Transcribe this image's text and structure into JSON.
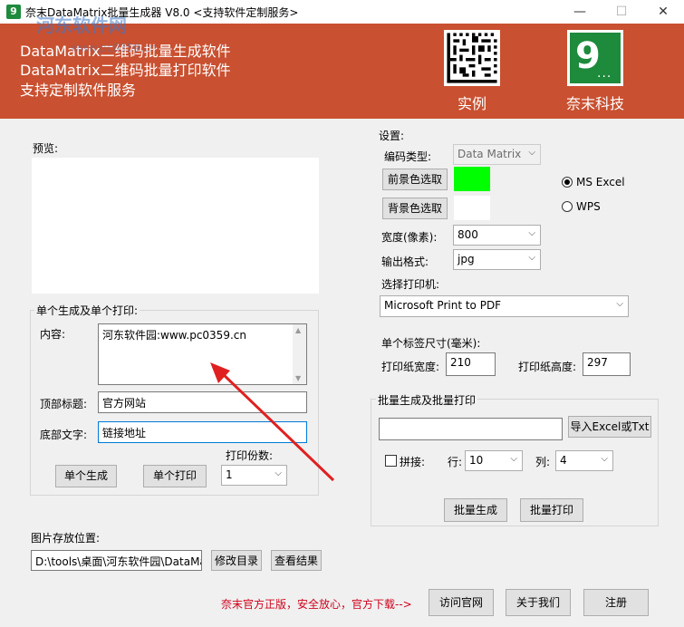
{
  "window": {
    "title": "奈末DataMatrix批量生成器 V8.0  <支持软件定制服务>",
    "app_icon": "9",
    "minimize": "—",
    "maximize": "☐",
    "close": "✕"
  },
  "watermark": {
    "text": "河东软件网",
    "url": "www.pc0359.cn"
  },
  "banner": {
    "lines": [
      "DataMatrix二维码批量生成软件",
      "DataMatrix二维码批量打印软件",
      "支持定制软件服务"
    ],
    "example_label": "实例",
    "company_label": "奈末科技",
    "logo_glyph": "9",
    "logo_dots": "...",
    "bg_color": "#c95030",
    "logo_color": "#1e8a3c"
  },
  "preview": {
    "label": "预览:"
  },
  "single": {
    "group_label": "单个生成及单个打印:",
    "content_label": "内容:",
    "content_value": "河东软件园:www.pc0359.cn",
    "top_title_label": "顶部标题:",
    "top_title_value": "官方网站",
    "bottom_text_label": "底部文字:",
    "bottom_text_value": "链接地址",
    "copies_label": "打印份数:",
    "copies_value": "1",
    "generate_button": "单个生成",
    "print_button": "单个打印"
  },
  "storage": {
    "label": "图片存放位置:",
    "path_value": "D:\\tools\\桌面\\河东软件园\\DataMa",
    "change_dir_button": "修改目录",
    "view_result_button": "查看结果"
  },
  "settings": {
    "group_label": "设置:",
    "code_type_label": "编码类型:",
    "code_type_value": "Data Matrix",
    "fg_color_button": "前景色选取",
    "fg_color": "#00ff00",
    "bg_color_button": "背景色选取",
    "bg_color": "#ffffff",
    "radio_ms_excel": "MS  Excel",
    "radio_wps": "WPS",
    "width_label": "宽度(像素):",
    "width_value": "800",
    "output_format_label": "输出格式:",
    "output_format_value": "jpg",
    "printer_label": "选择打印机:",
    "printer_value": "Microsoft Print to PDF",
    "label_size_label": "单个标签尺寸(毫米):",
    "paper_width_label": "打印纸宽度:",
    "paper_width_value": "210",
    "paper_height_label": "打印纸高度:",
    "paper_height_value": "297"
  },
  "batch": {
    "group_label": "批量生成及批量打印",
    "import_button": "导入Excel或Txt",
    "path_value": "",
    "tile_label": "拼接:",
    "rows_label": "行:",
    "rows_value": "10",
    "cols_label": "列:",
    "cols_value": "4",
    "generate_button": "批量生成",
    "print_button": "批量打印"
  },
  "footer": {
    "notice": "奈末官方正版，安全放心，官方下载-->",
    "visit_button": "访问官网",
    "about_button": "关于我们",
    "register_button": "注册"
  }
}
